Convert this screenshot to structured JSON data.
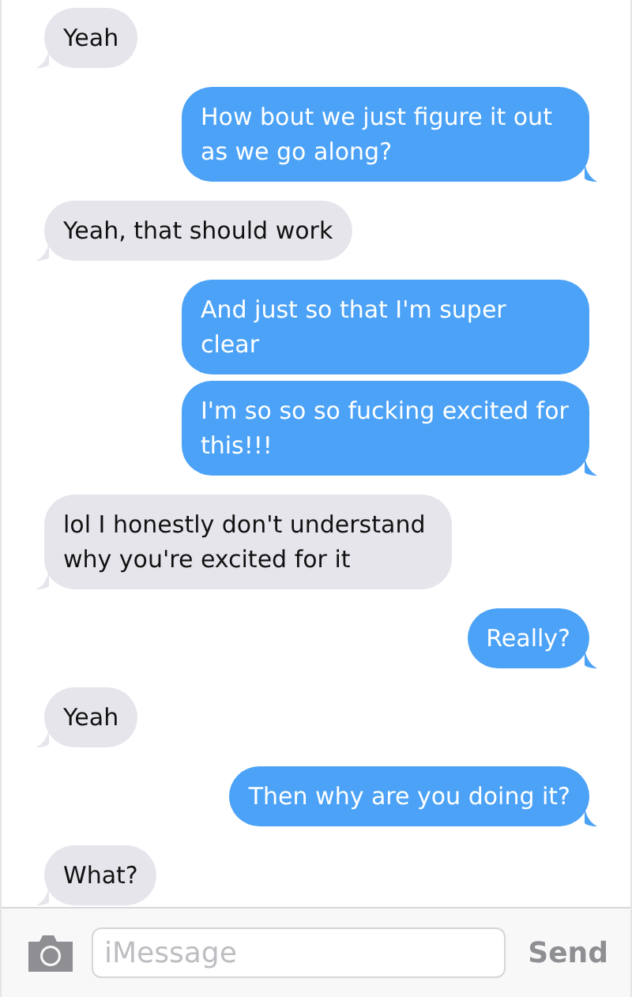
{
  "messages": [
    {
      "kind": "received",
      "text": "Yeah",
      "tail": true
    },
    {
      "kind": "sent",
      "text": "How bout we just figure it out as we go along?",
      "tail": true
    },
    {
      "kind": "received",
      "text": "Yeah, that should work",
      "tail": true
    },
    {
      "kind": "sent",
      "text": "And just so that I'm super clear",
      "tail": false
    },
    {
      "kind": "sent",
      "text": "I'm so so so fucking excited for this!!!",
      "tail": true
    },
    {
      "kind": "received",
      "text": "lol I honestly don't understand why you're excited for it",
      "tail": true
    },
    {
      "kind": "sent",
      "text": "Really?",
      "tail": true
    },
    {
      "kind": "received",
      "text": "Yeah",
      "tail": true
    },
    {
      "kind": "sent",
      "text": "Then why are you doing it?",
      "tail": true
    },
    {
      "kind": "received",
      "text": "What?",
      "tail": true
    }
  ],
  "composer": {
    "placeholder": "iMessage",
    "send": "Send"
  }
}
